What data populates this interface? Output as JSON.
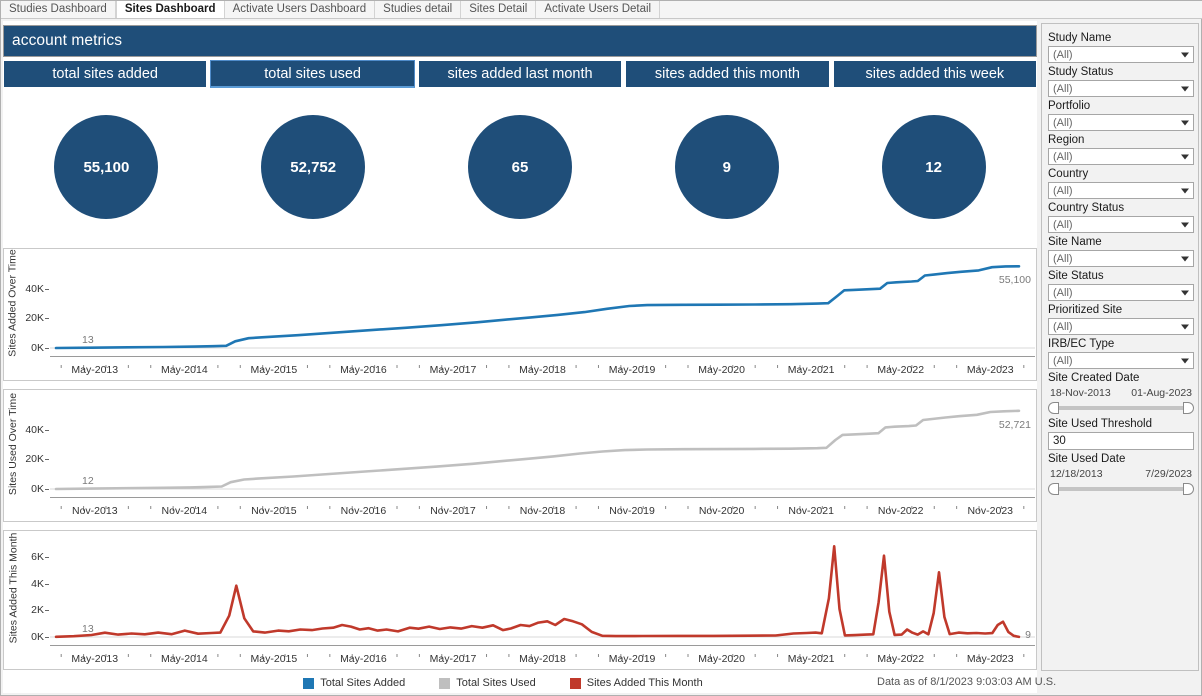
{
  "workbook_tabs": [
    {
      "label": "Studies Dashboard",
      "active": false
    },
    {
      "label": "Sites Dashboard",
      "active": true
    },
    {
      "label": "Activate Users Dashboard",
      "active": false
    },
    {
      "label": "Studies detail",
      "active": false
    },
    {
      "label": "Sites Detail",
      "active": false
    },
    {
      "label": "Activate Users Detail",
      "active": false
    }
  ],
  "header": {
    "title": "account metrics"
  },
  "kpis": [
    {
      "label": "total sites added",
      "value": "55,100",
      "selected": false
    },
    {
      "label": "total sites used",
      "value": "52,752",
      "selected": true
    },
    {
      "label": "sites added last month",
      "value": "65",
      "selected": false
    },
    {
      "label": "sites added this month",
      "value": "9",
      "selected": false
    },
    {
      "label": "sites added this week",
      "value": "12",
      "selected": false
    }
  ],
  "legend": [
    {
      "label": "Total Sites Added",
      "color": "#1f77b4"
    },
    {
      "label": "Total Sites Used",
      "color": "#bfbfbf"
    },
    {
      "label": "Sites Added This Month",
      "color": "#c0392b"
    }
  ],
  "footer": {
    "as_of": "Data as of 8/1/2023 9:03:03 AM U.S."
  },
  "filters": [
    {
      "label": "Study Name",
      "value": "(All)",
      "type": "select"
    },
    {
      "label": "Study Status",
      "value": "(All)",
      "type": "select"
    },
    {
      "label": "Portfolio",
      "value": "(All)",
      "type": "select"
    },
    {
      "label": "Region",
      "value": "(All)",
      "type": "select"
    },
    {
      "label": "Country",
      "value": "(All)",
      "type": "select"
    },
    {
      "label": "Country Status",
      "value": "(All)",
      "type": "select"
    },
    {
      "label": "Site Name",
      "value": "(All)",
      "type": "select"
    },
    {
      "label": "Site Status",
      "value": "(All)",
      "type": "select"
    },
    {
      "label": "Prioritized Site",
      "value": "(All)",
      "type": "select"
    },
    {
      "label": "IRB/EC Type",
      "value": "(All)",
      "type": "select"
    }
  ],
  "site_created_date": {
    "label": "Site Created Date",
    "start": "18-Nov-2013",
    "end": "01-Aug-2023"
  },
  "site_used_threshold": {
    "label": "Site Used Threshold",
    "value": "30"
  },
  "site_used_date": {
    "label": "Site Used Date",
    "start": "12/18/2013",
    "end": "7/29/2023"
  },
  "chart_data": [
    {
      "type": "line",
      "name": "sites-added-over-time",
      "title": "",
      "ylabel": "Sites Added Over Time",
      "xlabel": "",
      "color": "#1f77b4",
      "ylim": [
        0,
        60000
      ],
      "yticks": [
        0,
        20000,
        40000
      ],
      "yticklabels": [
        "0K",
        "20K",
        "40K"
      ],
      "xticklabels": [
        "May-2013",
        "May-2014",
        "May-2015",
        "May-2016",
        "May-2017",
        "May-2018",
        "May-2019",
        "May-2020",
        "May-2021",
        "May-2022",
        "May-2023"
      ],
      "start_label": "13",
      "end_label": "55,100",
      "grid": false,
      "points": [
        [
          0.0,
          13
        ],
        [
          0.04,
          200
        ],
        [
          0.08,
          450
        ],
        [
          0.12,
          700
        ],
        [
          0.155,
          950
        ],
        [
          0.175,
          1200
        ],
        [
          0.19,
          1500
        ],
        [
          0.2,
          4500
        ],
        [
          0.215,
          6600
        ],
        [
          0.23,
          7200
        ],
        [
          0.27,
          8600
        ],
        [
          0.31,
          10300
        ],
        [
          0.35,
          12000
        ],
        [
          0.39,
          13600
        ],
        [
          0.43,
          15400
        ],
        [
          0.47,
          17300
        ],
        [
          0.5,
          19000
        ],
        [
          0.53,
          20600
        ],
        [
          0.56,
          22300
        ],
        [
          0.59,
          24200
        ],
        [
          0.615,
          26400
        ],
        [
          0.64,
          28300
        ],
        [
          0.66,
          28900
        ],
        [
          0.7,
          29100
        ],
        [
          0.74,
          29200
        ],
        [
          0.78,
          29300
        ],
        [
          0.82,
          29500
        ],
        [
          0.85,
          29900
        ],
        [
          0.862,
          30200
        ],
        [
          0.872,
          35000
        ],
        [
          0.88,
          38900
        ],
        [
          0.89,
          39200
        ],
        [
          0.905,
          39600
        ],
        [
          0.92,
          40000
        ],
        [
          0.928,
          43800
        ],
        [
          0.938,
          44300
        ],
        [
          0.955,
          44800
        ],
        [
          0.962,
          45200
        ],
        [
          0.97,
          48900
        ],
        [
          0.98,
          49500
        ],
        [
          0.995,
          50500
        ],
        [
          1.01,
          51400
        ],
        [
          1.03,
          52300
        ],
        [
          1.045,
          54500
        ],
        [
          1.06,
          55000
        ],
        [
          1.075,
          55100
        ]
      ]
    },
    {
      "type": "line",
      "name": "sites-used-over-time",
      "title": "",
      "ylabel": "Sites Used Over Time",
      "xlabel": "",
      "color": "#bfbfbf",
      "ylim": [
        0,
        60000
      ],
      "yticks": [
        0,
        20000,
        40000
      ],
      "yticklabels": [
        "0K",
        "20K",
        "40K"
      ],
      "xticklabels": [
        "Nov-2013",
        "Nov-2014",
        "Nov-2015",
        "Nov-2016",
        "Nov-2017",
        "Nov-2018",
        "Nov-2019",
        "Nov-2020",
        "Nov-2021",
        "Nov-2022",
        "Nov-2023"
      ],
      "start_label": "12",
      "end_label": "52,721",
      "grid": false,
      "points": [
        [
          0.0,
          12
        ],
        [
          0.04,
          250
        ],
        [
          0.08,
          520
        ],
        [
          0.12,
          800
        ],
        [
          0.15,
          1050
        ],
        [
          0.17,
          1400
        ],
        [
          0.185,
          1700
        ],
        [
          0.195,
          4600
        ],
        [
          0.21,
          6400
        ],
        [
          0.225,
          7000
        ],
        [
          0.265,
          8400
        ],
        [
          0.305,
          10100
        ],
        [
          0.345,
          11800
        ],
        [
          0.385,
          13400
        ],
        [
          0.425,
          15100
        ],
        [
          0.465,
          17000
        ],
        [
          0.495,
          18700
        ],
        [
          0.525,
          20300
        ],
        [
          0.555,
          22000
        ],
        [
          0.585,
          23900
        ],
        [
          0.61,
          25300
        ],
        [
          0.635,
          26200
        ],
        [
          0.66,
          26600
        ],
        [
          0.7,
          26800
        ],
        [
          0.74,
          26900
        ],
        [
          0.78,
          27000
        ],
        [
          0.82,
          27200
        ],
        [
          0.85,
          27500
        ],
        [
          0.86,
          27800
        ],
        [
          0.87,
          33000
        ],
        [
          0.878,
          36500
        ],
        [
          0.89,
          36800
        ],
        [
          0.905,
          37200
        ],
        [
          0.918,
          37600
        ],
        [
          0.926,
          41500
        ],
        [
          0.936,
          42000
        ],
        [
          0.952,
          42400
        ],
        [
          0.96,
          42800
        ],
        [
          0.968,
          46500
        ],
        [
          0.978,
          47200
        ],
        [
          0.993,
          48200
        ],
        [
          1.008,
          49100
        ],
        [
          1.028,
          50000
        ],
        [
          1.043,
          51900
        ],
        [
          1.058,
          52400
        ],
        [
          1.075,
          52721
        ]
      ]
    },
    {
      "type": "line",
      "name": "sites-added-this-month",
      "title": "",
      "ylabel": "Sites Added This Month",
      "xlabel": "",
      "color": "#c0392b",
      "ylim": [
        0,
        7200
      ],
      "yticks": [
        0,
        2000,
        4000,
        6000
      ],
      "yticklabels": [
        "0K",
        "2K",
        "4K",
        "6K"
      ],
      "xticklabels": [
        "May-2013",
        "May-2014",
        "May-2015",
        "May-2016",
        "May-2017",
        "May-2018",
        "May-2019",
        "May-2020",
        "May-2021",
        "May-2022",
        "May-2023"
      ],
      "start_label": "13",
      "end_label": "9",
      "grid": false,
      "points": [
        [
          0.0,
          13
        ],
        [
          0.02,
          60
        ],
        [
          0.04,
          150
        ],
        [
          0.055,
          320
        ],
        [
          0.07,
          180
        ],
        [
          0.085,
          260
        ],
        [
          0.1,
          200
        ],
        [
          0.115,
          330
        ],
        [
          0.13,
          210
        ],
        [
          0.145,
          480
        ],
        [
          0.16,
          250
        ],
        [
          0.175,
          300
        ],
        [
          0.185,
          330
        ],
        [
          0.195,
          1600
        ],
        [
          0.203,
          3850
        ],
        [
          0.212,
          1400
        ],
        [
          0.222,
          420
        ],
        [
          0.235,
          330
        ],
        [
          0.25,
          480
        ],
        [
          0.262,
          430
        ],
        [
          0.275,
          560
        ],
        [
          0.288,
          520
        ],
        [
          0.3,
          640
        ],
        [
          0.312,
          700
        ],
        [
          0.322,
          900
        ],
        [
          0.332,
          780
        ],
        [
          0.342,
          560
        ],
        [
          0.352,
          660
        ],
        [
          0.362,
          480
        ],
        [
          0.372,
          560
        ],
        [
          0.385,
          420
        ],
        [
          0.398,
          700
        ],
        [
          0.408,
          620
        ],
        [
          0.42,
          780
        ],
        [
          0.432,
          600
        ],
        [
          0.444,
          720
        ],
        [
          0.456,
          630
        ],
        [
          0.468,
          820
        ],
        [
          0.48,
          700
        ],
        [
          0.492,
          880
        ],
        [
          0.503,
          520
        ],
        [
          0.512,
          640
        ],
        [
          0.523,
          900
        ],
        [
          0.533,
          820
        ],
        [
          0.543,
          1080
        ],
        [
          0.553,
          1180
        ],
        [
          0.562,
          900
        ],
        [
          0.572,
          1350
        ],
        [
          0.582,
          1180
        ],
        [
          0.592,
          950
        ],
        [
          0.603,
          380
        ],
        [
          0.615,
          90
        ],
        [
          0.63,
          70
        ],
        [
          0.66,
          75
        ],
        [
          0.7,
          80
        ],
        [
          0.74,
          85
        ],
        [
          0.78,
          95
        ],
        [
          0.81,
          110
        ],
        [
          0.83,
          260
        ],
        [
          0.845,
          300
        ],
        [
          0.855,
          330
        ],
        [
          0.862,
          280
        ],
        [
          0.87,
          2900
        ],
        [
          0.876,
          6800
        ],
        [
          0.882,
          2100
        ],
        [
          0.888,
          120
        ],
        [
          0.9,
          140
        ],
        [
          0.912,
          180
        ],
        [
          0.92,
          200
        ],
        [
          0.926,
          2600
        ],
        [
          0.932,
          6100
        ],
        [
          0.938,
          1900
        ],
        [
          0.944,
          160
        ],
        [
          0.952,
          180
        ],
        [
          0.958,
          560
        ],
        [
          0.964,
          320
        ],
        [
          0.97,
          180
        ],
        [
          0.976,
          420
        ],
        [
          0.982,
          200
        ],
        [
          0.988,
          1800
        ],
        [
          0.994,
          4850
        ],
        [
          1.0,
          1500
        ],
        [
          1.006,
          220
        ],
        [
          1.016,
          330
        ],
        [
          1.026,
          280
        ],
        [
          1.036,
          300
        ],
        [
          1.046,
          260
        ],
        [
          1.054,
          290
        ],
        [
          1.06,
          900
        ],
        [
          1.066,
          1150
        ],
        [
          1.072,
          380
        ],
        [
          1.078,
          90
        ],
        [
          1.084,
          9
        ]
      ]
    }
  ]
}
